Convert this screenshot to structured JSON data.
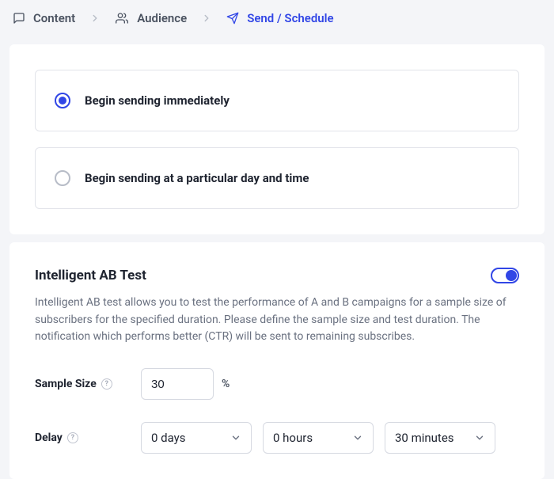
{
  "steps": {
    "content": "Content",
    "audience": "Audience",
    "send": "Send / Schedule"
  },
  "options": {
    "immediate": "Begin sending immediately",
    "scheduled": "Begin sending at a particular day and time"
  },
  "ab": {
    "title": "Intelligent AB Test",
    "description": "Intelligent AB test allows you to test the performance of A and B campaigns for a sample size of subscribers for the specified duration. Please define the sample size and test duration. The notification which performs better (CTR) will be sent to remaining subscribes.",
    "sample_label": "Sample Size",
    "sample_value": "30",
    "sample_unit": "%",
    "delay_label": "Delay",
    "delay_days": "0 days",
    "delay_hours": "0 hours",
    "delay_minutes": "30 minutes",
    "help_glyph": "?"
  }
}
